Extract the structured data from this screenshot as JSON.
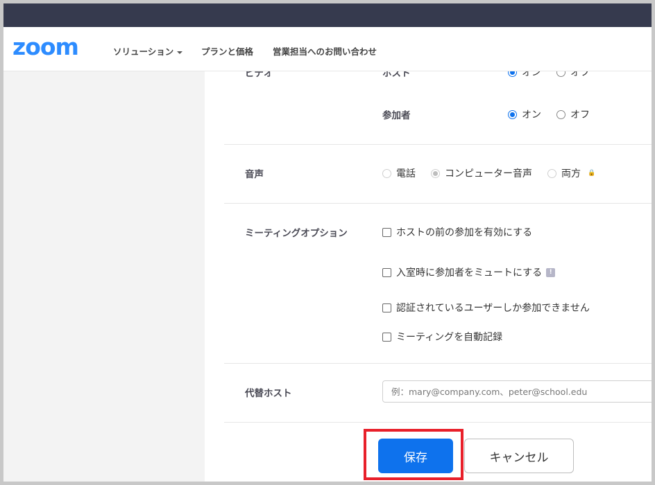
{
  "header": {
    "logo": "zoom",
    "nav": [
      {
        "label": "ソリューション"
      },
      {
        "label": "プランと価格"
      },
      {
        "label": "営業担当へのお問い合わせ"
      }
    ]
  },
  "video": {
    "section_label": "ビデオ",
    "host_label": "ホスト",
    "participant_label": "参加者",
    "options": [
      "オン",
      "オフ"
    ],
    "host_value": "オン",
    "participant_value": "オン"
  },
  "audio": {
    "label": "音声",
    "options": [
      "電話",
      "コンピューター音声",
      "両方"
    ],
    "value": "コンピューター音声",
    "locked": true
  },
  "meeting_options": {
    "label": "ミーティングオプション",
    "items": [
      {
        "label": "ホストの前の参加を有効にする",
        "checked": false
      },
      {
        "label": "入室時に参加者をミュートにする",
        "checked": false
      },
      {
        "label": "認証されているユーザーしか参加できません",
        "checked": false
      },
      {
        "label": "ミーティングを自動記録",
        "checked": false
      }
    ]
  },
  "alt_host": {
    "label": "代替ホスト",
    "placeholder": "例：mary@company.com、peter@school.edu",
    "value": ""
  },
  "actions": {
    "save_label": "保存",
    "cancel_label": "キャンセル"
  },
  "colors": {
    "accent": "#0e72ed",
    "logo": "#2d8cff",
    "highlight": "#e8202a",
    "topbar": "#363a4e"
  }
}
